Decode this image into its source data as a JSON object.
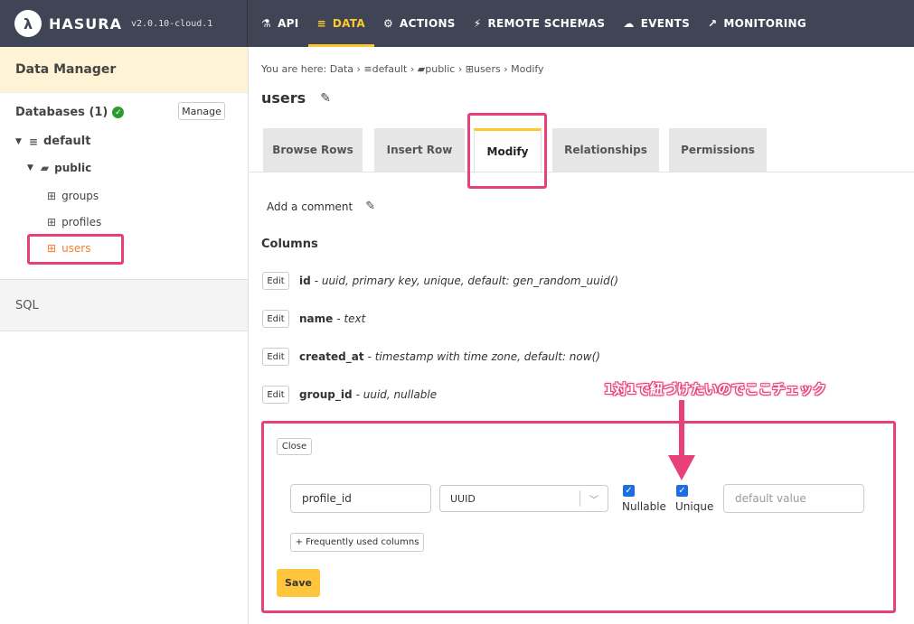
{
  "brand": {
    "name": "HASURA",
    "version": "v2.0.10-cloud.1"
  },
  "nav": [
    {
      "label": "API",
      "icon": "flask-icon"
    },
    {
      "label": "DATA",
      "icon": "database-icon"
    },
    {
      "label": "ACTIONS",
      "icon": "cogs-icon"
    },
    {
      "label": "REMOTE SCHEMAS",
      "icon": "plug-icon"
    },
    {
      "label": "EVENTS",
      "icon": "cloud-icon"
    },
    {
      "label": "MONITORING",
      "icon": "chart-line-icon"
    }
  ],
  "sidebar": {
    "header": "Data Manager",
    "databases_label": "Databases (1)",
    "manage_label": "Manage",
    "db_name": "default",
    "schema_name": "public",
    "tables": [
      "groups",
      "profiles",
      "users"
    ],
    "active_table": "users",
    "sql_label": "SQL"
  },
  "breadcrumb": {
    "prefix": "You are here:",
    "items": [
      "Data",
      "default",
      "public",
      "users",
      "Modify"
    ]
  },
  "page": {
    "title": "users"
  },
  "tabs": [
    "Browse Rows",
    "Insert Row",
    "Modify",
    "Relationships",
    "Permissions"
  ],
  "active_tab": "Modify",
  "comment_label": "Add a comment",
  "columns_heading": "Columns",
  "edit_label": "Edit",
  "columns": [
    {
      "name": "id",
      "desc": "- uuid, primary key, unique, default: gen_random_uuid()"
    },
    {
      "name": "name",
      "desc": "- text"
    },
    {
      "name": "created_at",
      "desc": "- timestamp with time zone, default: now()"
    },
    {
      "name": "group_id",
      "desc": "- uuid, nullable"
    }
  ],
  "new_column": {
    "close_label": "Close",
    "name_value": "profile_id",
    "type_value": "UUID",
    "nullable_label": "Nullable",
    "nullable_checked": true,
    "unique_label": "Unique",
    "unique_checked": true,
    "default_placeholder": "default value",
    "frequent_label": "+ Frequently used columns",
    "save_label": "Save"
  },
  "annotation": {
    "text": "1対1で紐づけたいのでここチェック",
    "color": "#e8407a"
  },
  "colors": {
    "topbar": "#3f4554",
    "accent": "#ffc82e",
    "active_table": "#f47e2c",
    "checkbox": "#1b6fe0"
  }
}
